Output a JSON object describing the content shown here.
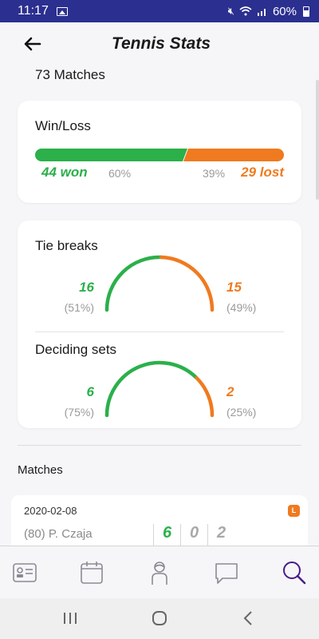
{
  "status_bar": {
    "time": "11:17",
    "battery_text": "60%"
  },
  "header": {
    "title": "Tennis Stats"
  },
  "summary": {
    "matches_count": "73 Matches"
  },
  "win_loss": {
    "title": "Win/Loss",
    "won_label": "44 won",
    "won_pct_text": "60%",
    "lost_pct_text": "39%",
    "lost_label": "29 lost",
    "won_fraction": 0.6,
    "lost_fraction": 0.39
  },
  "tie_breaks": {
    "title": "Tie breaks",
    "won": "16",
    "won_pct": "(51%)",
    "lost": "15",
    "lost_pct": "(49%)",
    "won_fraction": 0.51
  },
  "deciding_sets": {
    "title": "Deciding sets",
    "won": "6",
    "won_pct": "(75%)",
    "lost": "2",
    "lost_pct": "(25%)",
    "won_fraction": 0.75
  },
  "matches_section": {
    "label": "Matches"
  },
  "match": {
    "date": "2020-02-08",
    "result_badge": "L",
    "opponent": "(80) P. Czaja",
    "scores": [
      "6",
      "0",
      "2"
    ]
  },
  "colors": {
    "won": "#2bb04a",
    "lost": "#f07a1f",
    "accent": "#2b2f8f",
    "active_tab": "#4a1a8a"
  },
  "tabs": [
    "profile-card-icon",
    "calendar-icon",
    "player-icon",
    "chat-icon",
    "search-icon"
  ],
  "active_tab": "search-icon"
}
